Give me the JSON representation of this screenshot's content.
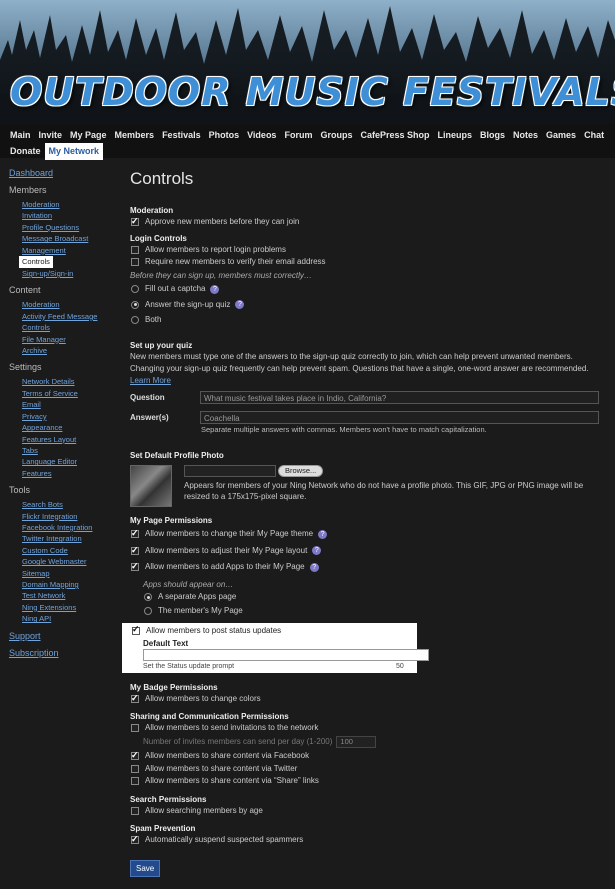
{
  "site_title": "OUTDOOR MUSIC FESTIVALS",
  "nav": {
    "row1": [
      "Main",
      "Invite",
      "My Page",
      "Members",
      "Festivals",
      "Photos",
      "Videos",
      "Forum",
      "Groups",
      "CafePress Shop",
      "Lineups",
      "Blogs",
      "Notes",
      "Games",
      "Chat"
    ],
    "row2": [
      "Donate",
      "My Network"
    ],
    "active": "My Network"
  },
  "sidebar": {
    "dashboard": "Dashboard",
    "sections": [
      {
        "title": "Members",
        "items": [
          "Moderation",
          "Invitation",
          "Profile Questions",
          "Message Broadcast",
          "Management",
          "Controls",
          "Sign-up/Sign-in"
        ]
      },
      {
        "title": "Content",
        "items": [
          "Moderation",
          "Activity Feed Message",
          "Controls",
          "File Manager",
          "Archive"
        ]
      },
      {
        "title": "Settings",
        "items": [
          "Network Details",
          "Terms of Service",
          "Email",
          "Privacy",
          "Appearance",
          "Features Layout",
          "Tabs",
          "Language Editor",
          "Features"
        ]
      },
      {
        "title": "Tools",
        "items": [
          "Search Bots",
          "Flickr Integration",
          "Facebook Integration",
          "Twitter Integration",
          "Custom Code",
          "Google Webmaster",
          "Sitemap",
          "Domain Mapping",
          "Test Network",
          "Ning Extensions",
          "Ning API"
        ]
      }
    ],
    "active_item": "Controls",
    "support": "Support",
    "subscription": "Subscription"
  },
  "main": {
    "title": "Controls",
    "moderation": {
      "title": "Moderation",
      "approve_label": "Approve new members before they can join",
      "approve_checked": true
    },
    "login": {
      "title": "Login Controls",
      "report_label": "Allow members to report login problems",
      "report_checked": false,
      "verify_label": "Require new members to verify their email address",
      "verify_checked": false,
      "before_label": "Before they can sign up, members must correctly…",
      "options": [
        "Fill out a captcha",
        "Answer the sign-up quiz",
        "Both"
      ],
      "selected": "Answer the sign-up quiz"
    },
    "quiz": {
      "title": "Set up your quiz",
      "description": "New members must type one of the answers to the sign-up quiz correctly to join, which can help prevent unwanted members. Changing your sign-up quiz frequently can help prevent spam. Questions that have a single, one-word answer are recommended.",
      "learn_more": "Learn More",
      "question_label": "Question",
      "question_value": "What music festival takes place in Indio, California?",
      "answers_label": "Answer(s)",
      "answers_value": "Coachella",
      "answers_note": "Separate multiple answers with commas. Members won't have to match capitalization."
    },
    "photo": {
      "title": "Set Default Profile Photo",
      "browse_label": "Browse...",
      "note": "Appears for members of your Ning Network who do not have a profile photo. This GIF, JPG or PNG image will be resized to a 175x175-pixel square."
    },
    "mypage": {
      "title": "My Page Permissions",
      "theme_label": "Allow members to change their My Page theme",
      "layout_label": "Allow members to adjust their My Page layout",
      "apps_label": "Allow members to add Apps to their My Page",
      "apps_appear": "Apps should appear on…",
      "apps_options": [
        "A separate Apps page",
        "The member's My Page"
      ],
      "apps_selected": "A separate Apps page",
      "status_label": "Allow members to post status updates",
      "default_text_label": "Default Text",
      "default_text_value": "",
      "default_text_note": "Set the Status update prompt",
      "default_text_count": "50"
    },
    "badge": {
      "title": "My Badge Permissions",
      "colors_label": "Allow members to change colors"
    },
    "sharing": {
      "title": "Sharing and Communication Permissions",
      "invitations_label": "Allow members to send invitations to the network",
      "invites_per_day_label": "Number of invites members can send per day (1-200)",
      "invites_per_day_value": "100",
      "facebook_label": "Allow members to share content via Facebook",
      "twitter_label": "Allow members to share content via Twitter",
      "share_links_label": "Allow members to share content via “Share” links"
    },
    "search": {
      "title": "Search Permissions",
      "age_label": "Allow searching members by age"
    },
    "spam": {
      "title": "Spam Prevention",
      "suspend_label": "Automatically suspend suspected spammers"
    },
    "save_label": "Save"
  }
}
